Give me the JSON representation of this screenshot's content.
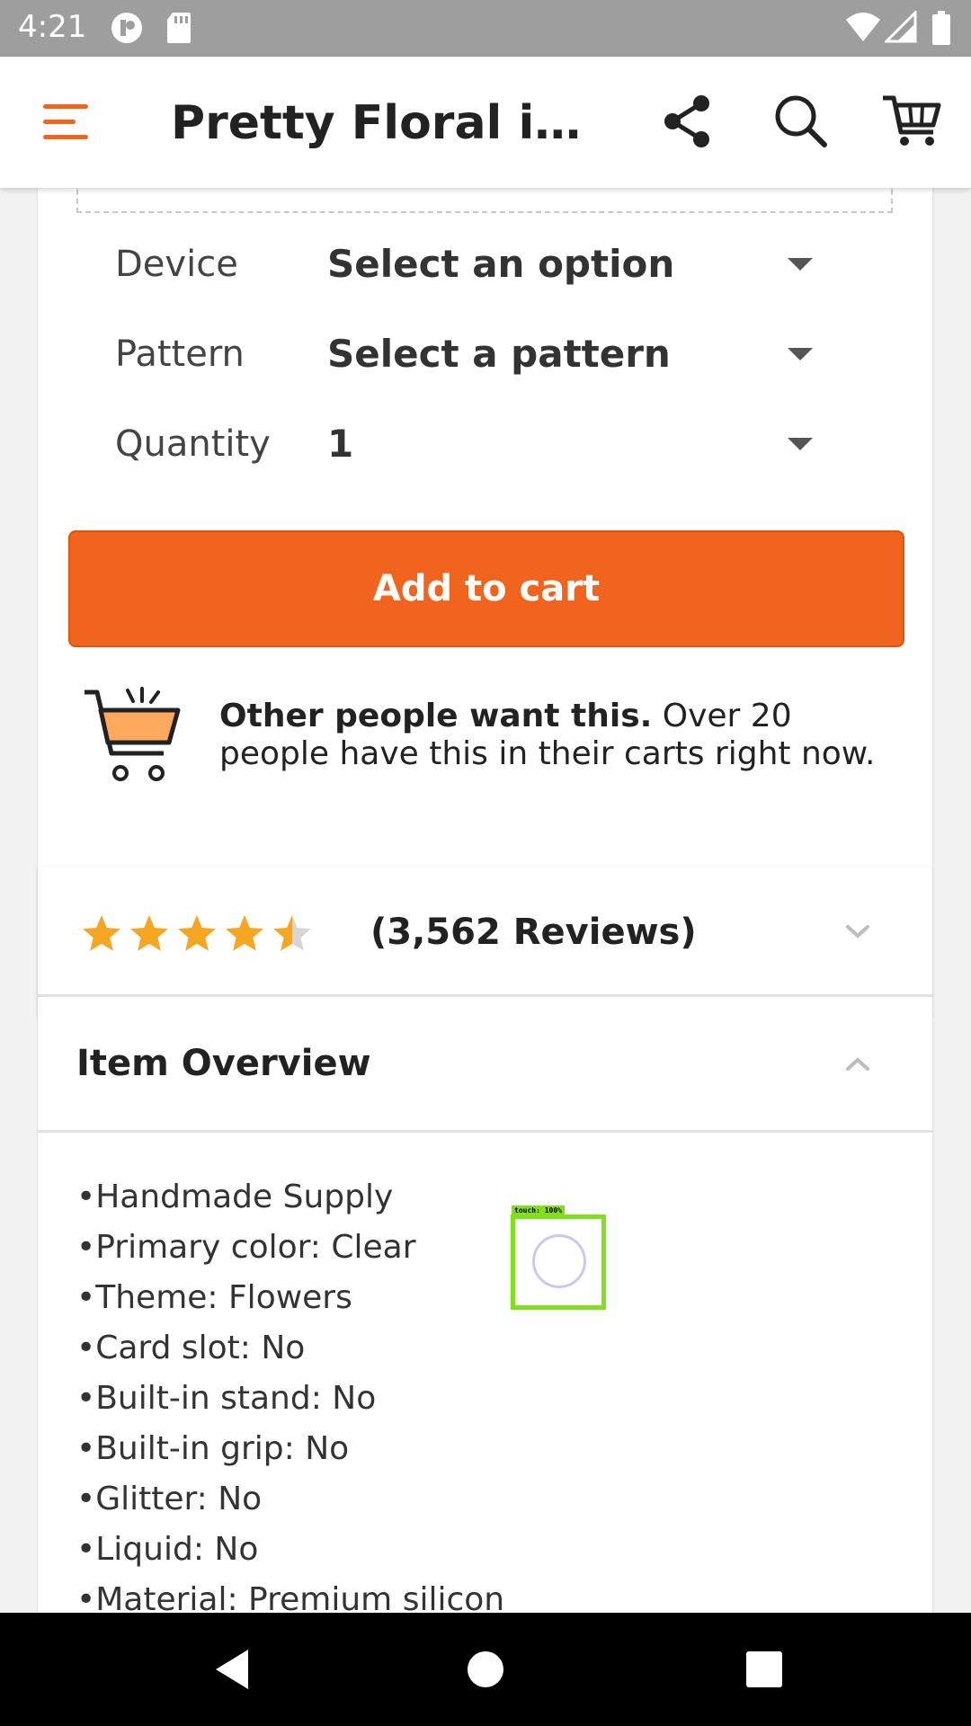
{
  "status_bar": {
    "time": "4:21"
  },
  "header": {
    "title": "Pretty Floral iPho..."
  },
  "options": [
    {
      "label": "Device",
      "value": "Select an option"
    },
    {
      "label": "Pattern",
      "value": "Select a pattern"
    },
    {
      "label": "Quantity",
      "value": "1"
    }
  ],
  "add_to_cart": "Add to cart",
  "social_proof": {
    "bold": "Other people want this.",
    "text": " Over 20 people have this in their carts right now."
  },
  "reviews": {
    "rating": 4.5,
    "max_rating": 5,
    "count_label": "(3,562 Reviews)"
  },
  "overview": {
    "title": "Item Overview",
    "items": [
      "Handmade Supply",
      "Primary color: Clear",
      "Theme: Flowers",
      "Card slot: No",
      "Built-in stand: No",
      "Built-in grip: No",
      "Glitter: No",
      "Liquid: No",
      "Material: Premium silicon"
    ]
  },
  "touch_indicator": {
    "label": "touch: 100%"
  },
  "colors": {
    "accent": "#f1641e",
    "star": "#f5a623",
    "header_bg": "#ffffff",
    "status_bar": "#9e9e9e"
  },
  "icons": [
    "menu-icon",
    "share-icon",
    "search-icon",
    "cart-icon",
    "chevron-down-icon",
    "chevron-up-icon",
    "back-icon",
    "home-icon",
    "recents-icon"
  ]
}
